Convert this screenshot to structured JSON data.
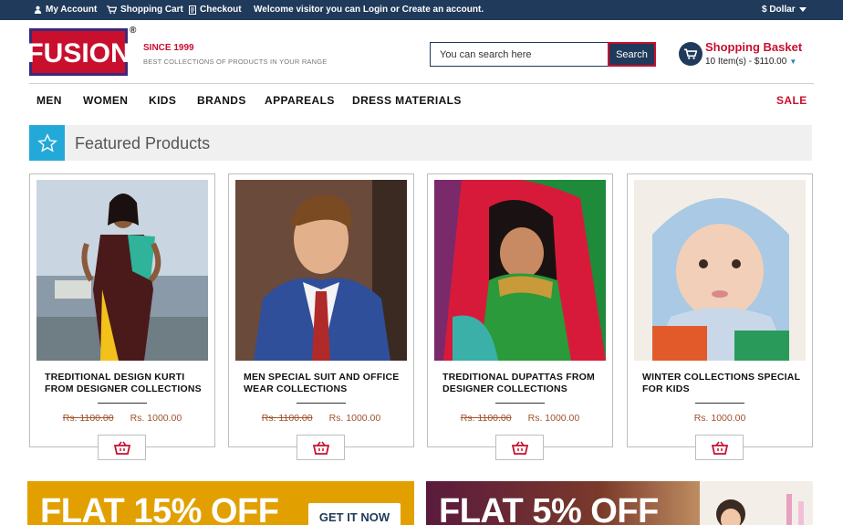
{
  "topbar": {
    "account": "My Account",
    "cart": "Shopping Cart",
    "checkout": "Checkout",
    "welcome": "Welcome visitor you can Login or Create an account.",
    "currency": "$ Dollar"
  },
  "header": {
    "logo_text": "FUSION",
    "registered": "®",
    "since": "SINCE 1999",
    "tagline": "BEST COLLECTIONS OF PRODUCTS IN YOUR RANGE",
    "search_placeholder": "You can search here",
    "search_button": "Search",
    "basket_title": "Shopping Basket",
    "basket_summary": "10 Item(s) - $110.00"
  },
  "nav": {
    "items": [
      "MEN",
      "WOMEN",
      "KIDS",
      "BRANDS",
      "APPAREALS",
      "DRESS MATERIALS"
    ],
    "sale": "SALE"
  },
  "featured": {
    "title": "Featured Products"
  },
  "products": [
    {
      "name": "TREDITIONAL DESIGN KURTI FROM DESIGNER COLLECTIONS",
      "old_price": "Rs. 1100.00",
      "price": "Rs. 1000.00"
    },
    {
      "name": "MEN SPECIAL SUIT AND OFFICE WEAR COLLECTIONS",
      "old_price": "Rs. 1100.00",
      "price": "Rs. 1000.00"
    },
    {
      "name": "TREDITIONAL DUPATTAS FROM DESIGNER COLLECTIONS",
      "old_price": "Rs. 1100.00",
      "price": "Rs. 1000.00"
    },
    {
      "name": "WINTER COLLECTIONS SPECIAL FOR KIDS",
      "old_price": "",
      "price": "Rs. 1000.00"
    }
  ],
  "promos": [
    {
      "headline": "FLAT 15% OFF",
      "button": "GET IT NOW"
    },
    {
      "headline": "FLAT 5% OFF"
    }
  ],
  "colors": {
    "topbar": "#1f3a5a",
    "brand_red": "#c8102e",
    "accent_blue": "#23a9d8",
    "price": "#a0522d",
    "promo_yellow": "#e2a000"
  },
  "icons": {
    "account": "user-icon",
    "cart": "cart-icon",
    "checkout": "checkout-icon",
    "currency_dropdown": "caret-down-icon",
    "featured": "star-icon",
    "add_to_cart": "basket-icon"
  }
}
